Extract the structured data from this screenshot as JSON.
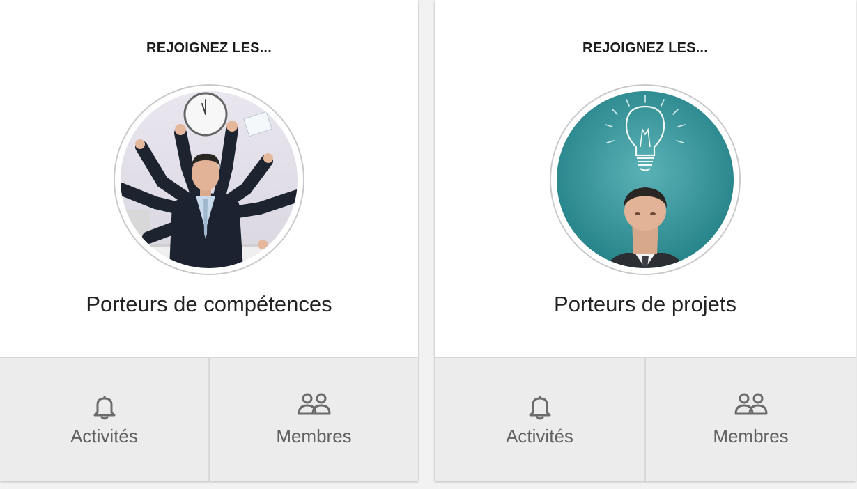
{
  "colors": {
    "card_bg": "#ffffff",
    "actions_bg": "#ececec",
    "action_text": "#616161",
    "title_text": "#222222",
    "teal_photo_bg": "#2a8b91"
  },
  "cards": [
    {
      "kicker": "REJOIGNEZ LES...",
      "title": "Porteurs de compétences",
      "image_icon": "businessman-many-arms-clock-image",
      "actions": [
        {
          "label": "Activités",
          "icon": "bell-icon"
        },
        {
          "label": "Membres",
          "icon": "members-icon"
        }
      ]
    },
    {
      "kicker": "REJOIGNEZ LES...",
      "title": "Porteurs de projets",
      "image_icon": "man-lightbulb-idea-image",
      "actions": [
        {
          "label": "Activités",
          "icon": "bell-icon"
        },
        {
          "label": "Membres",
          "icon": "members-icon"
        }
      ]
    }
  ]
}
